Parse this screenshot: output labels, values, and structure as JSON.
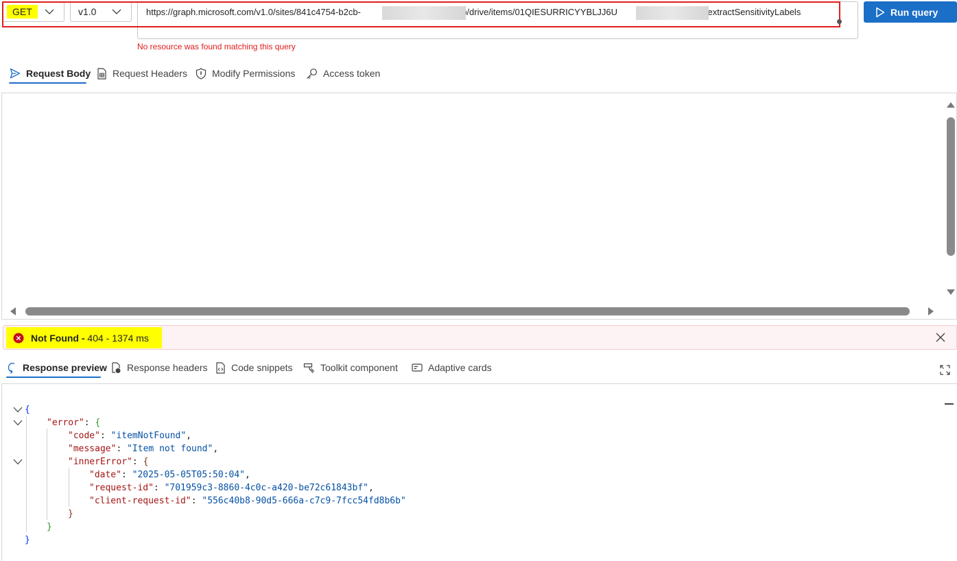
{
  "query": {
    "method": "GET",
    "version": "v1.0",
    "url_part1": "https://graph.microsoft.com/v1.0/sites/841c4754-b2cb-",
    "url_part2": "491fb/drive/items/01QIESURRICYYBLJJ6U",
    "url_part3": "TWI/extractSensitivityLabels",
    "error_message": "No resource was found matching this query",
    "run_label": "Run query"
  },
  "request_tabs": [
    {
      "label": "Request Body",
      "icon": "send-icon",
      "active": true
    },
    {
      "label": "Request Headers",
      "icon": "document-table-icon",
      "active": false
    },
    {
      "label": "Modify Permissions",
      "icon": "shield-icon",
      "active": false
    },
    {
      "label": "Access token",
      "icon": "key-icon",
      "active": false
    }
  ],
  "status": {
    "label": "Not Found -",
    "detail": "404 - 1374 ms",
    "icon": "error-circle-icon",
    "color": "#c50f1f"
  },
  "response_tabs": [
    {
      "label": "Response preview",
      "icon": "response-icon",
      "active": true
    },
    {
      "label": "Response headers",
      "icon": "headers-icon",
      "active": false
    },
    {
      "label": "Code snippets",
      "icon": "code-file-icon",
      "active": false
    },
    {
      "label": "Toolkit component",
      "icon": "toolkit-icon",
      "active": false
    },
    {
      "label": "Adaptive cards",
      "icon": "card-icon",
      "active": false
    }
  ],
  "response_json": {
    "error_key": "\"error\"",
    "code_key": "\"code\"",
    "code_val": "\"itemNotFound\"",
    "message_key": "\"message\"",
    "message_val": "\"Item not found\"",
    "inner_key": "\"innerError\"",
    "date_key": "\"date\"",
    "date_val": "\"2025-05-05T05:50:04\"",
    "request_id_key": "\"request-id\"",
    "request_id_val": "\"701959c3-8860-4c0c-a420-be72c61843bf\"",
    "client_request_id_key": "\"client-request-id\"",
    "client_request_id_val": "\"556c40b8-90d5-666a-c7c9-7fcc54fd8b6b\""
  },
  "colors": {
    "accent": "#1b6fc7",
    "highlight": "#ffff00",
    "annotation_frame": "#e21c1c",
    "error_text": "#e01b1b",
    "status_bg": "#fdf3f4"
  }
}
